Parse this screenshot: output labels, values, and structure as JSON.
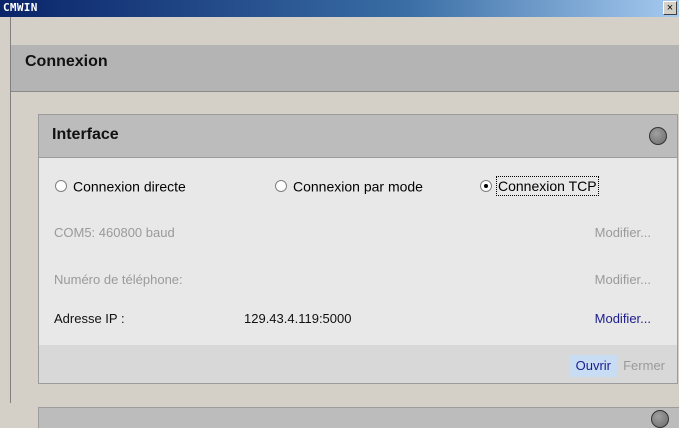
{
  "window": {
    "title": "CMWIN",
    "close_glyph": "×"
  },
  "section": {
    "title": "Connexion"
  },
  "interface": {
    "title": "Interface",
    "radios": [
      {
        "label": "Connexion directe",
        "checked": false
      },
      {
        "label": "Connexion par mode",
        "checked": false
      },
      {
        "label": "Connexion TCP",
        "checked": true
      }
    ],
    "rows": [
      {
        "label": "COM5: 460800 baud",
        "value": "",
        "action": "Modifier..."
      },
      {
        "label": "Numéro de téléphone:",
        "value": "",
        "action": "Modifier..."
      },
      {
        "label": "Adresse IP :",
        "value": "129.43.4.119:5000",
        "action": "Modifier..."
      }
    ],
    "buttons": {
      "open": "Ouvrir",
      "close": "Fermer"
    }
  },
  "colors": {
    "title_bar": "#0a246a",
    "link": "#1c1c8c",
    "disabled": "#9a9a9a",
    "open_button_bg": "#c8dcf4"
  }
}
